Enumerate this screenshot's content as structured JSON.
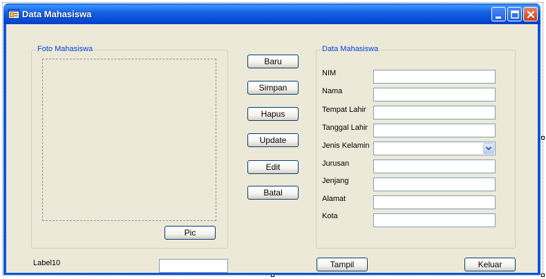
{
  "window": {
    "title": "Data Mahasiswa"
  },
  "foto_group": {
    "legend": "Foto Mahasiswa",
    "pic_button": "Pic"
  },
  "actions": {
    "baru": "Baru",
    "simpan": "Simpan",
    "hapus": "Hapus",
    "update": "Update",
    "edit": "Edit",
    "batal": "Batal"
  },
  "data_group": {
    "legend": "Data Mahasiswa",
    "fields": {
      "nim": {
        "label": "NIM",
        "value": ""
      },
      "nama": {
        "label": "Nama",
        "value": ""
      },
      "tempat_lahir": {
        "label": "Tempat Lahir",
        "value": ""
      },
      "tanggal_lahir": {
        "label": "Tanggal Lahir",
        "value": ""
      },
      "jenis_kelamin": {
        "label": "Jenis Kelamin",
        "value": ""
      },
      "jurusan": {
        "label": "Jurusan",
        "value": ""
      },
      "jenjang": {
        "label": "Jenjang",
        "value": ""
      },
      "alamat": {
        "label": "Alamat",
        "value": ""
      },
      "kota": {
        "label": "Kota",
        "value": ""
      }
    }
  },
  "bottom": {
    "label10": "Label10",
    "label10_value": "",
    "tampil": "Tampil",
    "keluar": "Keluar"
  },
  "icons": {
    "app": "form-icon",
    "minimize": "minimize-icon",
    "maximize": "maximize-icon",
    "close": "close-icon",
    "dropdown": "chevron-down-icon"
  },
  "colors": {
    "titlebar": "#0a55e0",
    "client_bg": "#ece9d8",
    "legend_text": "#0046d5",
    "close_button": "#c4431f",
    "button_border": "#003c74",
    "textbox_border": "#7f9db9"
  }
}
